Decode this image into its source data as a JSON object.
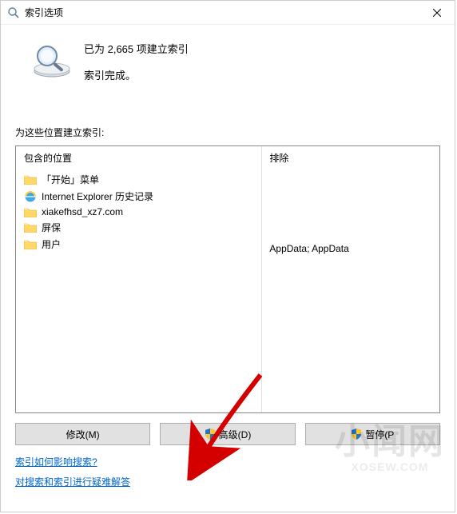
{
  "titlebar": {
    "icon": "search-icon",
    "title": "索引选项"
  },
  "status": {
    "line1": "已为 2,665 项建立索引",
    "line2": "索引完成。"
  },
  "section_label": "为这些位置建立索引:",
  "columns": {
    "included_header": "包含的位置",
    "excluded_header": "排除"
  },
  "locations": [
    {
      "icon": "folder",
      "label": "「开始」菜单",
      "exclude": ""
    },
    {
      "icon": "ie",
      "label": "Internet Explorer 历史记录",
      "exclude": ""
    },
    {
      "icon": "folder",
      "label": "xiakefhsd_xz7.com",
      "exclude": ""
    },
    {
      "icon": "folder",
      "label": "屏保",
      "exclude": ""
    },
    {
      "icon": "folder",
      "label": "用户",
      "exclude": "AppData; AppData"
    }
  ],
  "buttons": {
    "modify": "修改(M)",
    "advanced": "高级(D)",
    "pause": "暂停(P"
  },
  "links": {
    "help1": "索引如何影响搜索?",
    "help2": "对搜索和索引进行疑难解答"
  },
  "watermark": {
    "main": "小闻网",
    "sub": "XOSEW.COM"
  },
  "annotation": {
    "arrow_color": "#d40000"
  }
}
